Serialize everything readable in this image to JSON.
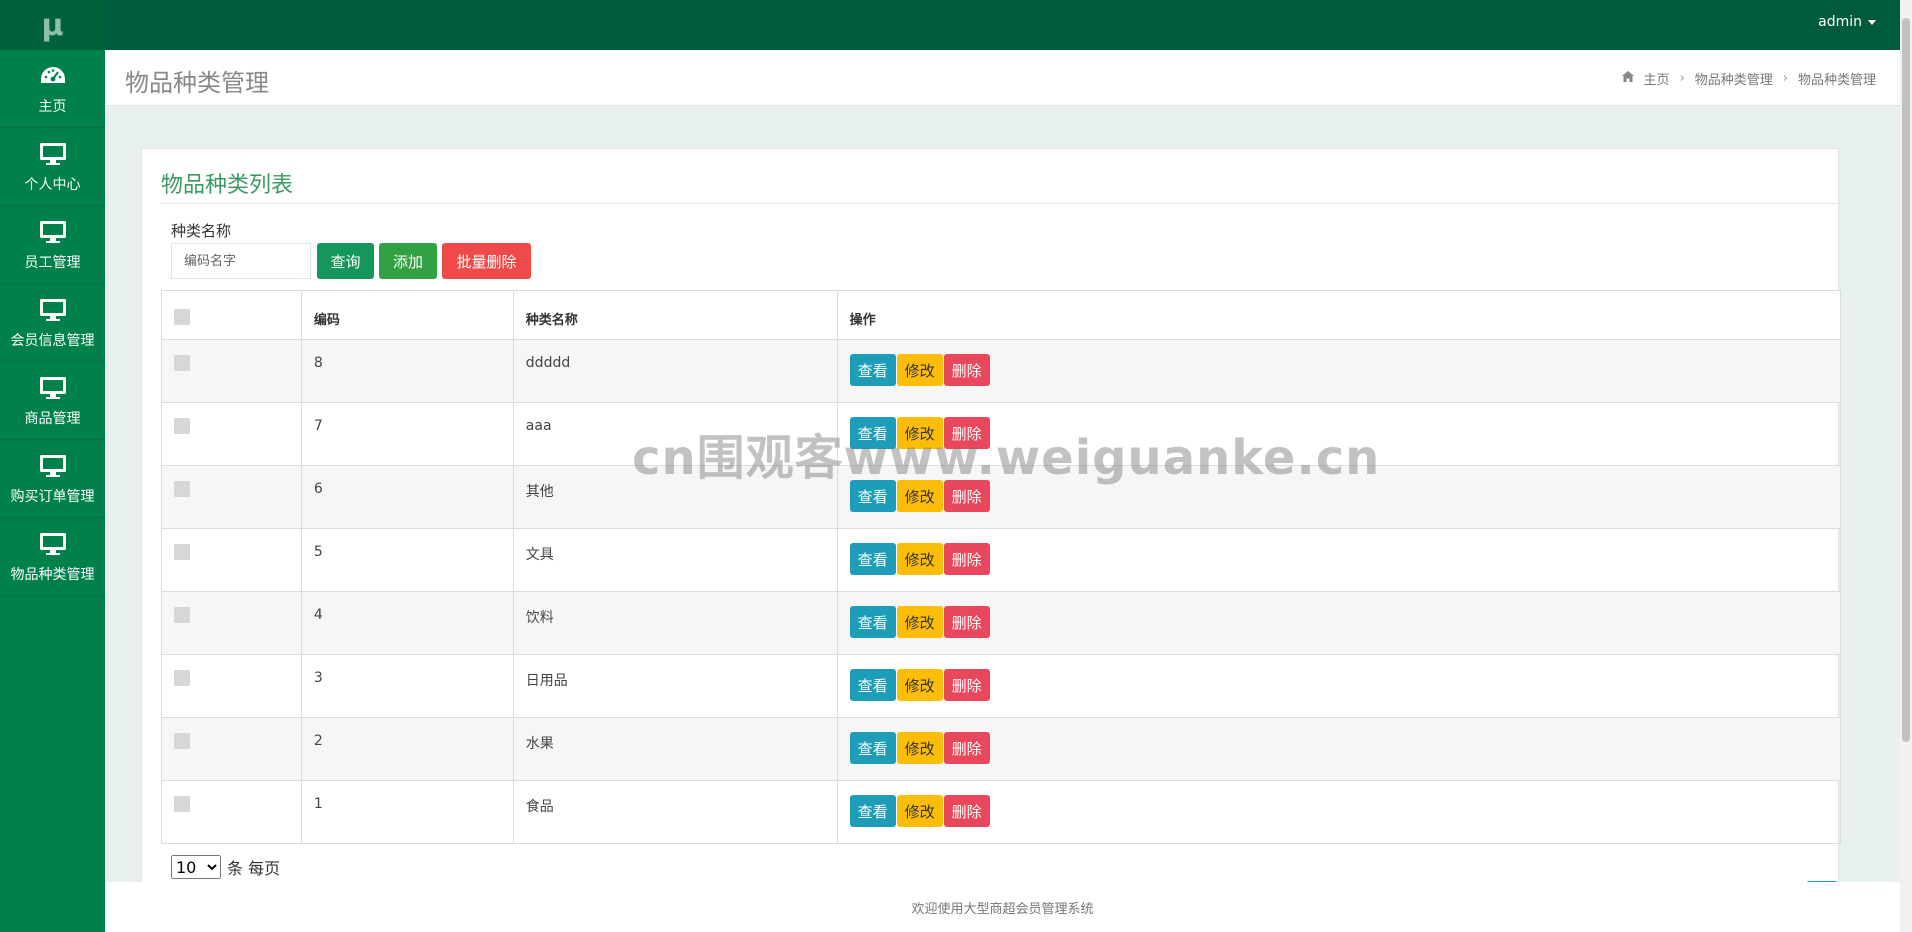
{
  "logo": "μ",
  "sidebar": {
    "items": [
      {
        "label": "主页",
        "icon": "dashboard-icon"
      },
      {
        "label": "个人中心",
        "icon": "monitor-icon"
      },
      {
        "label": "员工管理",
        "icon": "monitor-icon"
      },
      {
        "label": "会员信息管理",
        "icon": "monitor-icon"
      },
      {
        "label": "商品管理",
        "icon": "monitor-icon"
      },
      {
        "label": "购买订单管理",
        "icon": "monitor-icon"
      },
      {
        "label": "物品种类管理",
        "icon": "monitor-icon"
      }
    ]
  },
  "topbar": {
    "user": "admin"
  },
  "page": {
    "title": "物品种类管理",
    "breadcrumb": [
      "主页",
      "物品种类管理",
      "物品种类管理"
    ]
  },
  "card": {
    "title": "物品种类列表"
  },
  "filter": {
    "label": "种类名称",
    "placeholder": "编码名字",
    "query_label": "查询",
    "add_label": "添加",
    "batch_delete_label": "批量删除"
  },
  "table": {
    "headers": [
      "",
      "编码",
      "种类名称",
      "操作"
    ],
    "rows": [
      {
        "code": "8",
        "name": "ddddd"
      },
      {
        "code": "7",
        "name": "aaa"
      },
      {
        "code": "6",
        "name": "其他"
      },
      {
        "code": "5",
        "name": "文具"
      },
      {
        "code": "4",
        "name": "饮料"
      },
      {
        "code": "3",
        "name": "日用品"
      },
      {
        "code": "2",
        "name": "水果"
      },
      {
        "code": "1",
        "name": "食品"
      }
    ],
    "actions": {
      "view": "查看",
      "edit": "修改",
      "delete": "删除"
    }
  },
  "pagination": {
    "page_size": "10",
    "options": [
      "10"
    ],
    "suffix": "条 每页"
  },
  "footer": "欢迎使用大型商超会员管理系统",
  "watermark": "cn围观客www.weiguanke.cn",
  "colors": {
    "sidebar": "#00804a",
    "topbar": "#005a3c",
    "view": "#1e9db9",
    "edit": "#fbbd08",
    "delete": "#e9475b"
  }
}
